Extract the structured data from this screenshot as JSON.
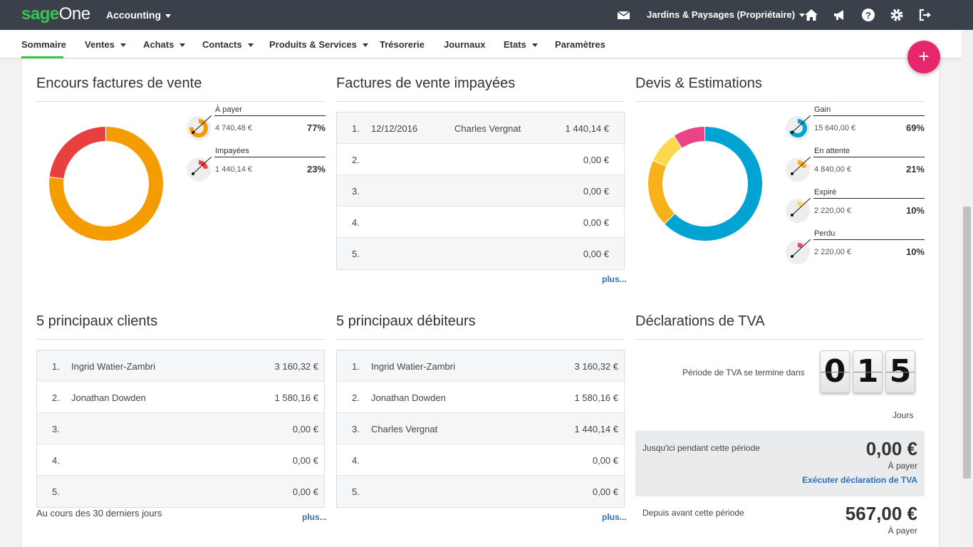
{
  "topbar": {
    "logo_sage": "sage",
    "logo_one": "One",
    "app_menu": "Accounting",
    "company": "Jardins & Paysages (Propriétaire)",
    "icons": [
      "mail-icon",
      "home-icon",
      "megaphone-icon",
      "help-icon",
      "gear-icon",
      "logout-icon"
    ]
  },
  "nav": {
    "items": [
      "Sommaire",
      "Ventes",
      "Achats",
      "Contacts",
      "Produits & Services",
      "Trésorerie",
      "Journaux",
      "Etats",
      "Paramètres"
    ],
    "active": "Sommaire",
    "fab": "+"
  },
  "encours": {
    "title": "Encours factures de vente",
    "legend": [
      {
        "label": "À payer",
        "amount": "4 740,48 €",
        "pct": "77%",
        "value": 77,
        "color": "#f59c00"
      },
      {
        "label": "Impayées",
        "amount": "1 440,14 €",
        "pct": "23%",
        "value": 23,
        "color": "#e8403e"
      }
    ]
  },
  "impayees": {
    "title": "Factures de vente impayées",
    "rows": [
      {
        "num": "1.",
        "date": "12/12/2016",
        "name": "Charles Vergnat",
        "amount": "1 440,14 €"
      },
      {
        "num": "2.",
        "date": "",
        "name": "",
        "amount": "0,00 €"
      },
      {
        "num": "3.",
        "date": "",
        "name": "",
        "amount": "0,00 €"
      },
      {
        "num": "4.",
        "date": "",
        "name": "",
        "amount": "0,00 €"
      },
      {
        "num": "5.",
        "date": "",
        "name": "",
        "amount": "0,00 €"
      }
    ],
    "more": "plus..."
  },
  "devis": {
    "title": "Devis & Estimations",
    "legend": [
      {
        "label": "Gain",
        "amount": "15 640,00 €",
        "pct": "69%",
        "value": 69,
        "color": "#00a3d1"
      },
      {
        "label": "En attente",
        "amount": "4 840,00 €",
        "pct": "21%",
        "value": 21,
        "color": "#f7b11b"
      },
      {
        "label": "Expiré",
        "amount": "2 220,00 €",
        "pct": "10%",
        "value": 10,
        "color": "#fcd94c"
      },
      {
        "label": "Perdu",
        "amount": "2 220,00 €",
        "pct": "10%",
        "value": 10,
        "color": "#ea4388"
      }
    ]
  },
  "clients": {
    "title": "5 principaux clients",
    "rows": [
      {
        "num": "1.",
        "name": "Ingrid Watier-Zambri",
        "amount": "3 160,32 €"
      },
      {
        "num": "2.",
        "name": "Jonathan Dowden",
        "amount": "1 580,16 €"
      },
      {
        "num": "3.",
        "name": "",
        "amount": "0,00 €"
      },
      {
        "num": "4.",
        "name": "",
        "amount": "0,00 €"
      },
      {
        "num": "5.",
        "name": "",
        "amount": "0,00 €"
      }
    ],
    "footnote": "Au cours des 30 derniers jours",
    "more": "plus..."
  },
  "debiteurs": {
    "title": "5 principaux débiteurs",
    "rows": [
      {
        "num": "1.",
        "name": "Ingrid Watier-Zambri",
        "amount": "3 160,32 €"
      },
      {
        "num": "2.",
        "name": "Jonathan Dowden",
        "amount": "1 580,16 €"
      },
      {
        "num": "3.",
        "name": "Charles Vergnat",
        "amount": "1 440,14 €"
      },
      {
        "num": "4.",
        "name": "",
        "amount": "0,00 €"
      },
      {
        "num": "5.",
        "name": "",
        "amount": "0,00 €"
      }
    ],
    "more": "plus..."
  },
  "tva": {
    "title": "Déclarations de TVA",
    "period_label": "Période de TVA se termine dans",
    "digits": [
      "0",
      "1",
      "5"
    ],
    "days_label": "Jours",
    "current_label": "Jusqu'ici pendant cette période",
    "current_amount": "0,00 €",
    "current_sub": "À payer",
    "action": "Exécuter déclaration de TVA",
    "previous_label": "Depuis avant cette période",
    "previous_amount": "567,00 €",
    "previous_sub": "À payer"
  },
  "colors": {
    "topbar": "#3a414b",
    "brand_green": "#3bc34f",
    "accent_pink": "#e8266d",
    "link_blue": "#2e6fb7"
  }
}
